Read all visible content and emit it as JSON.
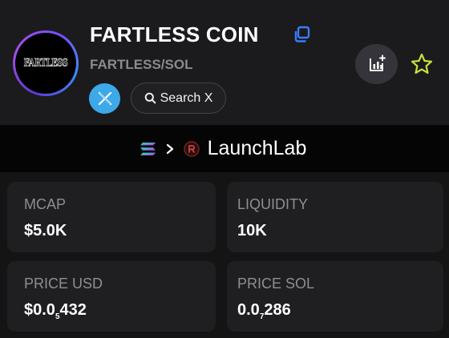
{
  "token": {
    "name": "FARTLESS COIN",
    "pair": "FARTLESS/SOL",
    "logo_text": "FARTLESS"
  },
  "actions": {
    "search_x_label": "Search X"
  },
  "platform": {
    "label": "LaunchLab"
  },
  "stats": {
    "mcap": {
      "label": "MCAP",
      "value": "$5.0K"
    },
    "liquidity": {
      "label": "LIQUIDITY",
      "value": "10K"
    },
    "price_usd": {
      "label": "PRICE USD",
      "prefix": "$0.0",
      "zeros": "5",
      "digits": "432"
    },
    "price_sol": {
      "label": "PRICE SOL",
      "prefix": "0.0",
      "zeros": "7",
      "digits": "286"
    }
  },
  "colors": {
    "accent_blue": "#3b7bff",
    "x_blue": "#3ea9e9",
    "star_yellow": "#c6e23a",
    "muted_text": "#8a8a8f"
  }
}
